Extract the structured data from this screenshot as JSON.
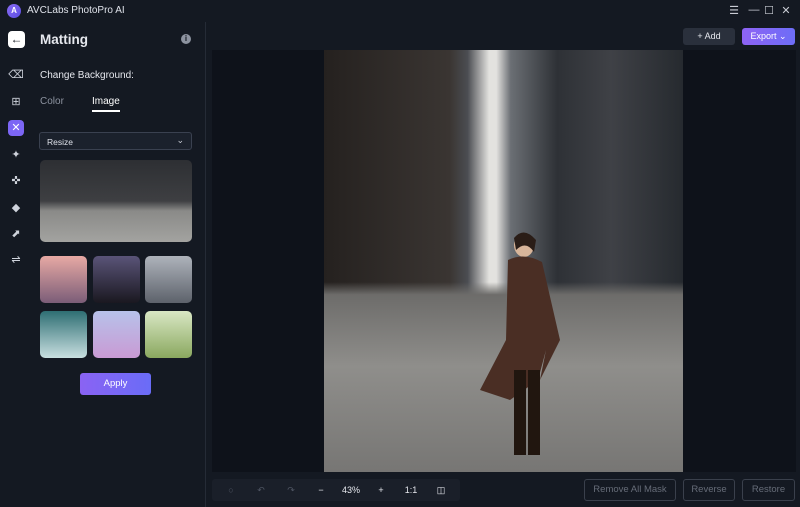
{
  "app": {
    "title": "AVCLabs PhotoPro AI",
    "logo_text": "A"
  },
  "window_controls": {
    "menu": "☰",
    "minimize": "—",
    "maximize": "☐",
    "close": "✕"
  },
  "panel": {
    "title": "Matting",
    "info": "i",
    "change_background": "Change Background:",
    "tabs": [
      {
        "label": "Color",
        "active": false
      },
      {
        "label": "Image",
        "active": true
      }
    ],
    "resize_select": {
      "value": "Resize"
    },
    "apply": "Apply",
    "thumbnails": [
      {
        "name": "pink-mountain",
        "colors": [
          "#e7a9a4",
          "#7b5d78"
        ]
      },
      {
        "name": "night-sky",
        "colors": [
          "#5a5478",
          "#1a1820"
        ]
      },
      {
        "name": "snowy-mountain",
        "colors": [
          "#aeb3bb",
          "#5d626b"
        ]
      },
      {
        "name": "ocean-waves",
        "colors": [
          "#2e6e73",
          "#c8dfe0"
        ]
      },
      {
        "name": "pastel-clouds",
        "colors": [
          "#b7c2ea",
          "#c99ad4"
        ]
      },
      {
        "name": "green-bokeh",
        "colors": [
          "#d9e7c4",
          "#8aa85f"
        ]
      }
    ]
  },
  "rail_icons": [
    "back-arrow-icon",
    "eraser-icon",
    "enhance-icon",
    "matting-icon",
    "face-icon",
    "object-remove-icon",
    "colorize-icon",
    "upscale-icon",
    "adjust-icon"
  ],
  "header": {
    "add": "+ Add",
    "export": "Export ⌄"
  },
  "toolbar": {
    "zoom": "43%",
    "minus": "−",
    "plus": "+",
    "one_to_one": "1:1",
    "compare": "◫",
    "reset": "○",
    "undo": "↶",
    "redo": "↷"
  },
  "actions": {
    "remove_all_mask": "Remove All Mask",
    "reverse": "Reverse",
    "restore": "Restore"
  },
  "colors": {
    "accent": "#7c66f5",
    "background": "#141922"
  }
}
